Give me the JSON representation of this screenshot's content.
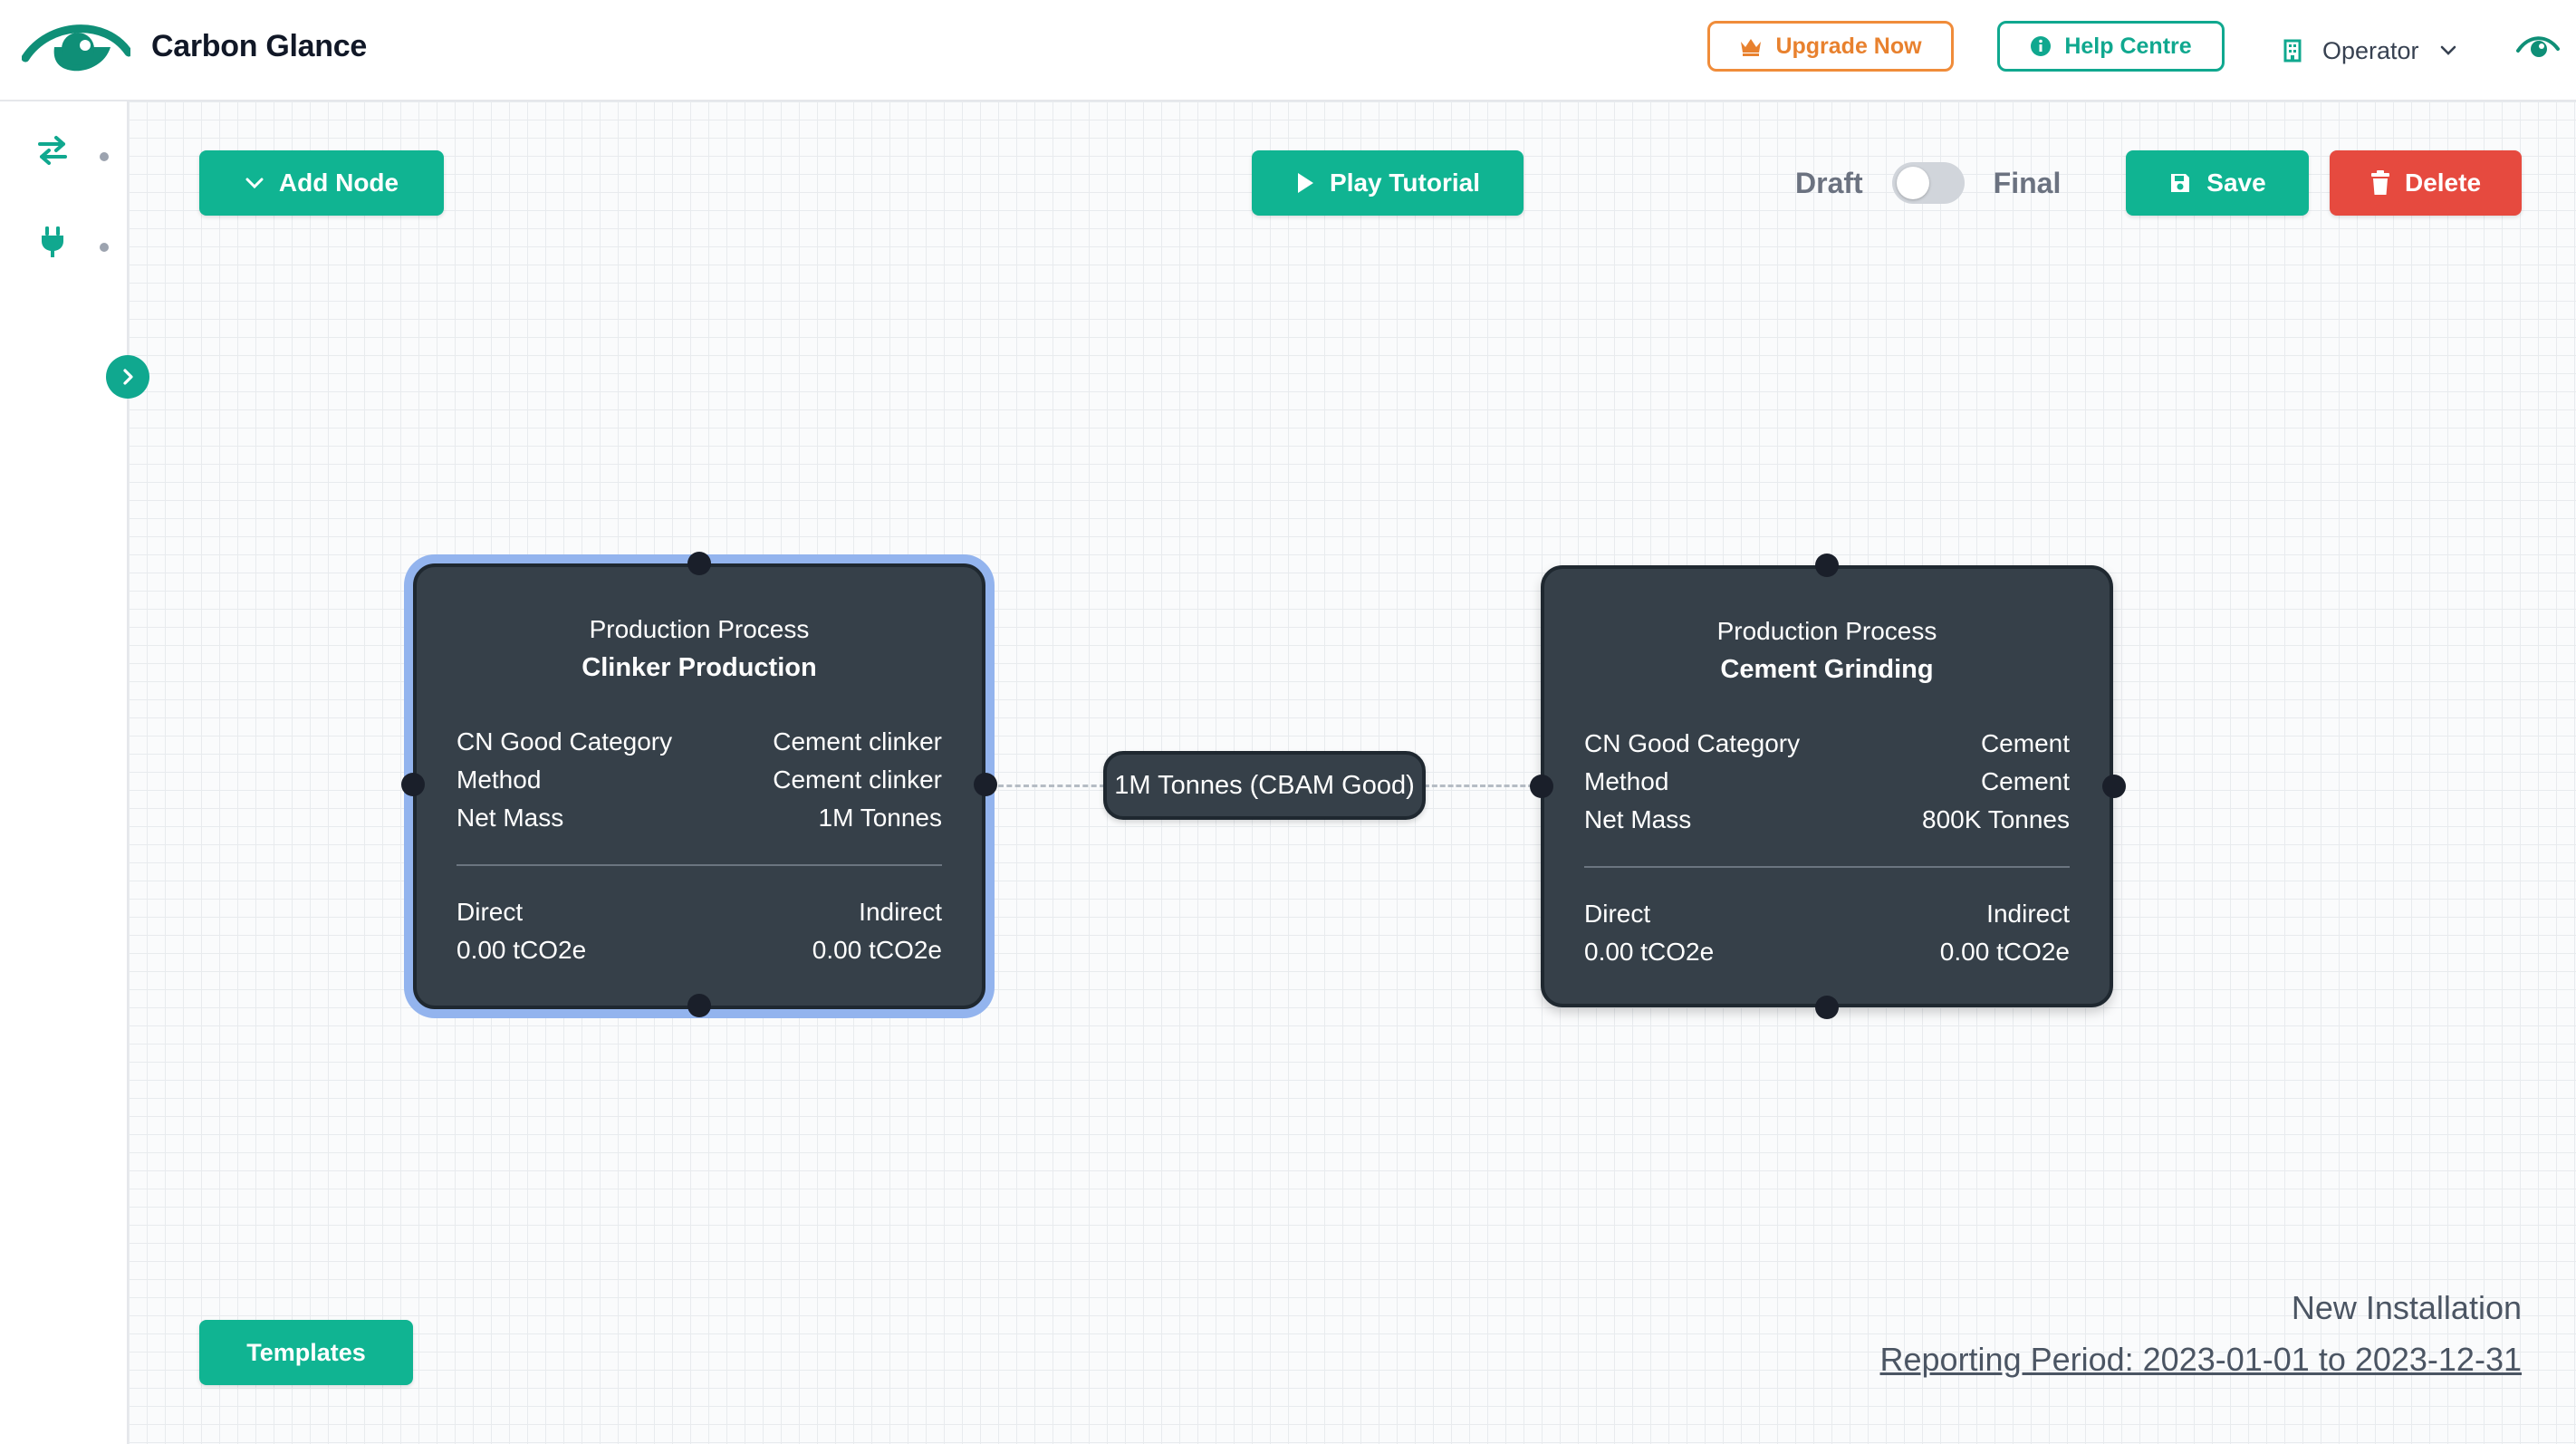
{
  "app": {
    "title": "Carbon Glance",
    "brand_color": "#10a88f"
  },
  "header": {
    "upgrade_label": "Upgrade Now",
    "upgrade_icon": "crown-icon",
    "help_label": "Help Centre",
    "help_icon": "info-icon",
    "role_icon": "building-icon",
    "role_label": "Operator",
    "toggle_eye_icon": "eye-icon"
  },
  "sidebar": {
    "items": [
      {
        "icon": "arrows-exchange-icon"
      },
      {
        "icon": "plug-icon"
      }
    ],
    "expand_icon": "chevron-right-icon"
  },
  "toolbar": {
    "add_node_label": "Add Node",
    "play_tutorial_label": "Play Tutorial",
    "draft_label": "Draft",
    "final_label": "Final",
    "save_label": "Save",
    "delete_label": "Delete",
    "templates_label": "Templates",
    "status_is_final": false
  },
  "nodes": [
    {
      "type": "Production Process",
      "name": "Clinker Production",
      "selected": true,
      "rows": [
        {
          "label": "CN Good Category",
          "value": "Cement clinker"
        },
        {
          "label": "Method",
          "value": "Cement clinker"
        },
        {
          "label": "Net Mass",
          "value": "1M Tonnes"
        }
      ],
      "direct_label": "Direct",
      "indirect_label": "Indirect",
      "direct_value": "0.00 tCO2e",
      "indirect_value": "0.00 tCO2e"
    },
    {
      "type": "Production Process",
      "name": "Cement Grinding",
      "selected": false,
      "rows": [
        {
          "label": "CN Good Category",
          "value": "Cement"
        },
        {
          "label": "Method",
          "value": "Cement"
        },
        {
          "label": "Net Mass",
          "value": "800K Tonnes"
        }
      ],
      "direct_label": "Direct",
      "indirect_label": "Indirect",
      "direct_value": "0.00 tCO2e",
      "indirect_value": "0.00 tCO2e"
    }
  ],
  "edge": {
    "label": "1M Tonnes (CBAM Good)"
  },
  "footer": {
    "installation": "New Installation",
    "reporting_period": "Reporting Period: 2023-01-01 to 2023-12-31"
  }
}
